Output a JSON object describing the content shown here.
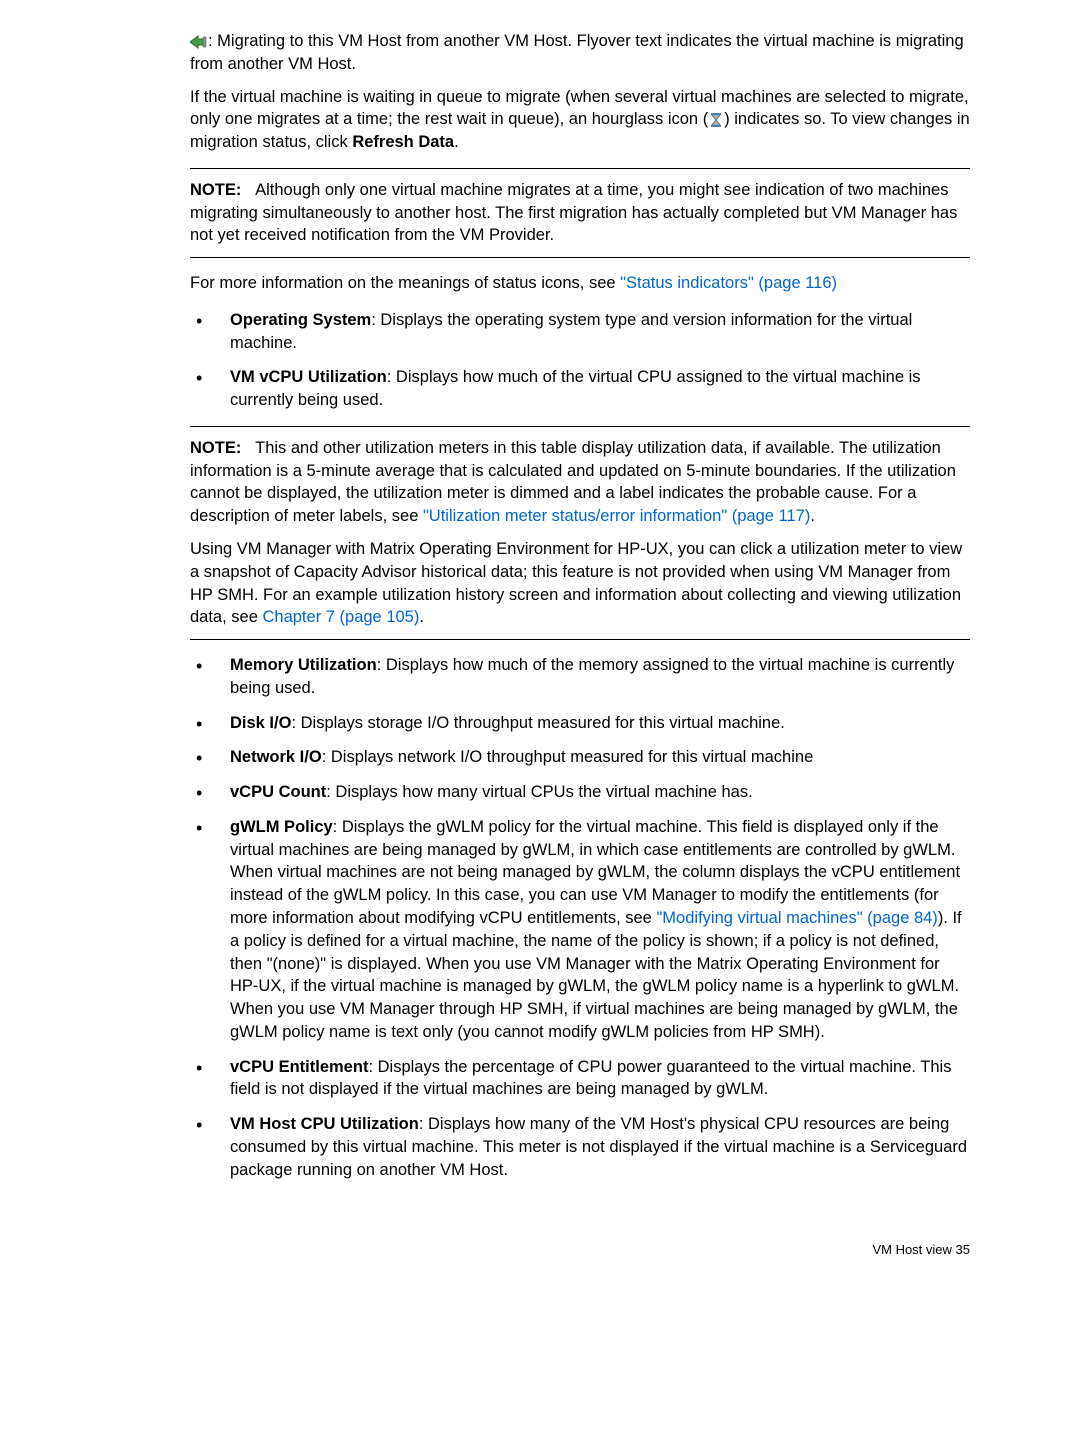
{
  "top": {
    "migrate_line": ": Migrating to this VM Host from another VM Host. Flyover text indicates the virtual machine is migrating from another VM Host.",
    "queue_line_a": "If the virtual machine is waiting in queue to migrate (when several virtual machines are selected to migrate, only one migrates at a time; the rest wait in queue), an hourglass icon (",
    "queue_line_b": ") indicates so. To view changes in migration status, click ",
    "refresh_data": "Refresh Data",
    "queue_line_c": "."
  },
  "note1": {
    "label": "NOTE:",
    "text": "Although only one virtual machine migrates at a time, you might see indication of two machines migrating simultaneously to another host. The first migration has actually completed but VM Manager has not yet received notification from the VM Provider."
  },
  "status_line_a": "For more information on the meanings of status icons, see ",
  "status_link": "\"Status indicators\" (page 116)",
  "bullets": {
    "os": {
      "title": "Operating System",
      "text": ": Displays the operating system type and version information for the virtual machine."
    },
    "vcpu_util": {
      "title": "VM vCPU Utilization",
      "text": ": Displays how much of the virtual CPU assigned to the virtual machine is currently being used."
    },
    "mem_util": {
      "title": "Memory Utilization",
      "text": ": Displays how much of the memory assigned to the virtual machine is currently being used."
    },
    "disk_io": {
      "title": "Disk I/O",
      "text": ": Displays storage I/O throughput measured for this virtual machine."
    },
    "net_io": {
      "title": "Network I/O",
      "text": ": Displays network I/O throughput measured for this virtual machine"
    },
    "vcpu_count": {
      "title": "vCPU Count",
      "text": ": Displays how many virtual CPUs the virtual machine has."
    },
    "gwlm": {
      "title": "gWLM Policy",
      "text_a": ": Displays the gWLM policy for the virtual machine. This field is displayed only if the virtual machines are being managed by gWLM, in which case entitlements are controlled by gWLM. When virtual machines are not being managed by gWLM, the column displays the vCPU entitlement instead of the gWLM policy. In this case, you can use VM Manager to modify the entitlements (for more information about modifying vCPU entitlements, see ",
      "link": "\"Modifying virtual machines\" (page 84)",
      "text_b": "). If a policy is defined for a virtual machine, the name of the policy is shown; if a policy is not defined, then \"(none)\" is displayed. When you use VM Manager with the Matrix Operating Environment for HP-UX, if the virtual machine is managed by gWLM, the gWLM policy name is a hyperlink to gWLM. When you use VM Manager through HP SMH, if virtual machines are being managed by gWLM, the gWLM policy name is text only (you cannot modify gWLM policies from HP SMH)."
    },
    "vcpu_ent": {
      "title": "vCPU Entitlement",
      "text": ": Displays the percentage of CPU power guaranteed to the virtual machine. This field is not displayed if the virtual machines are being managed by gWLM."
    },
    "host_cpu": {
      "title": "VM Host CPU Utilization",
      "text": ": Displays how many of the VM Host's physical CPU resources are being consumed by this virtual machine. This meter is not displayed if the virtual machine is a Serviceguard package running on another VM Host."
    }
  },
  "note2": {
    "label": "NOTE:",
    "text_a": "This and other utilization meters in this table display utilization data, if available. The utilization information is a 5-minute average that is calculated and updated on 5-minute boundaries. If the utilization cannot be displayed, the utilization meter is dimmed and a label indicates the probable cause. For a description of meter labels, see ",
    "link1": "\"Utilization meter status/error information\" (page 117)",
    "text_b": ".",
    "para2_a": "Using VM Manager with Matrix Operating Environment for HP-UX, you can click a utilization meter to view a snapshot of Capacity Advisor historical data; this feature is not provided when using VM Manager from HP SMH. For an example utilization history screen and information about collecting and viewing utilization data, see ",
    "link2": "Chapter 7 (page 105)",
    "para2_b": "."
  },
  "footer": "VM Host view    35"
}
